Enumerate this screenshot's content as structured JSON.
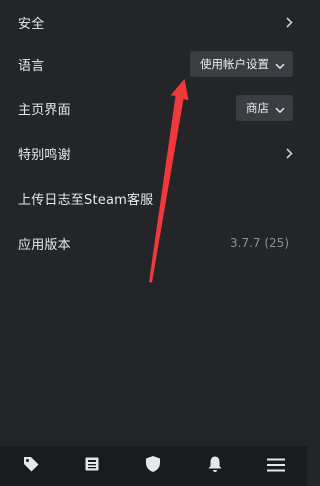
{
  "settings": {
    "security": {
      "label": "安全"
    },
    "language": {
      "label": "语言",
      "dropdown_value": "使用帐户设置"
    },
    "home": {
      "label": "主页界面",
      "dropdown_value": "商店"
    },
    "credits": {
      "label": "特别鸣谢"
    },
    "upload_log": {
      "label": "上传日志至Steam客服"
    },
    "app_version": {
      "label": "应用版本",
      "value": "3.7.7 (25)"
    }
  },
  "tabbar": {
    "tabs": [
      {
        "icon": "tag-icon"
      },
      {
        "icon": "news-icon"
      },
      {
        "icon": "shield-icon"
      },
      {
        "icon": "bell-icon"
      },
      {
        "icon": "menu-icon"
      }
    ]
  },
  "colors": {
    "background": "#232529",
    "tabbar_background": "#1a1b1e",
    "dropdown_background": "#3a3d42",
    "annotation_arrow": "#f0393a"
  }
}
